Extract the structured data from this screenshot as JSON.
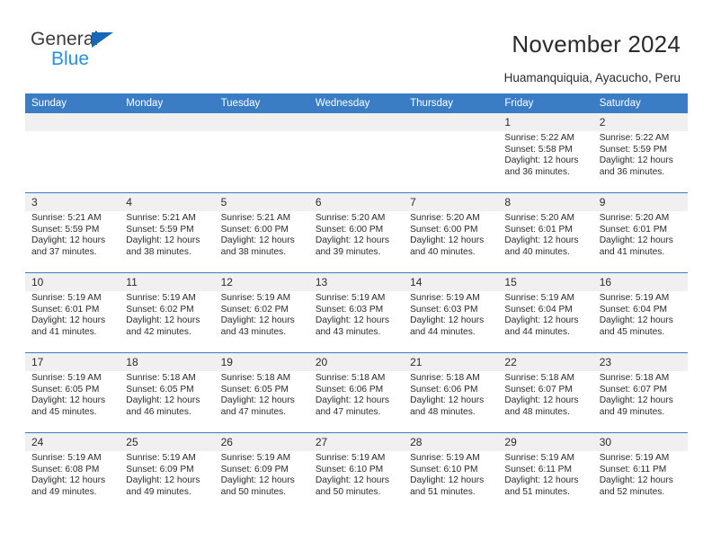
{
  "brand": {
    "name_part1": "General",
    "name_part2": "Blue",
    "accent_color": "#2a8fdd",
    "triangle_color": "#1667b5"
  },
  "header": {
    "title": "November 2024",
    "location": "Huamanquiquia, Ayacucho, Peru"
  },
  "calendar": {
    "header_bg": "#3b7dc4",
    "band_bg": "#f0f0f0",
    "weekdays": [
      "Sunday",
      "Monday",
      "Tuesday",
      "Wednesday",
      "Thursday",
      "Friday",
      "Saturday"
    ],
    "weeks": [
      [
        {
          "day": "",
          "sunrise": "",
          "sunset": "",
          "daylight1": "",
          "daylight2": ""
        },
        {
          "day": "",
          "sunrise": "",
          "sunset": "",
          "daylight1": "",
          "daylight2": ""
        },
        {
          "day": "",
          "sunrise": "",
          "sunset": "",
          "daylight1": "",
          "daylight2": ""
        },
        {
          "day": "",
          "sunrise": "",
          "sunset": "",
          "daylight1": "",
          "daylight2": ""
        },
        {
          "day": "",
          "sunrise": "",
          "sunset": "",
          "daylight1": "",
          "daylight2": ""
        },
        {
          "day": "1",
          "sunrise": "Sunrise: 5:22 AM",
          "sunset": "Sunset: 5:58 PM",
          "daylight1": "Daylight: 12 hours",
          "daylight2": "and 36 minutes."
        },
        {
          "day": "2",
          "sunrise": "Sunrise: 5:22 AM",
          "sunset": "Sunset: 5:59 PM",
          "daylight1": "Daylight: 12 hours",
          "daylight2": "and 36 minutes."
        }
      ],
      [
        {
          "day": "3",
          "sunrise": "Sunrise: 5:21 AM",
          "sunset": "Sunset: 5:59 PM",
          "daylight1": "Daylight: 12 hours",
          "daylight2": "and 37 minutes."
        },
        {
          "day": "4",
          "sunrise": "Sunrise: 5:21 AM",
          "sunset": "Sunset: 5:59 PM",
          "daylight1": "Daylight: 12 hours",
          "daylight2": "and 38 minutes."
        },
        {
          "day": "5",
          "sunrise": "Sunrise: 5:21 AM",
          "sunset": "Sunset: 6:00 PM",
          "daylight1": "Daylight: 12 hours",
          "daylight2": "and 38 minutes."
        },
        {
          "day": "6",
          "sunrise": "Sunrise: 5:20 AM",
          "sunset": "Sunset: 6:00 PM",
          "daylight1": "Daylight: 12 hours",
          "daylight2": "and 39 minutes."
        },
        {
          "day": "7",
          "sunrise": "Sunrise: 5:20 AM",
          "sunset": "Sunset: 6:00 PM",
          "daylight1": "Daylight: 12 hours",
          "daylight2": "and 40 minutes."
        },
        {
          "day": "8",
          "sunrise": "Sunrise: 5:20 AM",
          "sunset": "Sunset: 6:01 PM",
          "daylight1": "Daylight: 12 hours",
          "daylight2": "and 40 minutes."
        },
        {
          "day": "9",
          "sunrise": "Sunrise: 5:20 AM",
          "sunset": "Sunset: 6:01 PM",
          "daylight1": "Daylight: 12 hours",
          "daylight2": "and 41 minutes."
        }
      ],
      [
        {
          "day": "10",
          "sunrise": "Sunrise: 5:19 AM",
          "sunset": "Sunset: 6:01 PM",
          "daylight1": "Daylight: 12 hours",
          "daylight2": "and 41 minutes."
        },
        {
          "day": "11",
          "sunrise": "Sunrise: 5:19 AM",
          "sunset": "Sunset: 6:02 PM",
          "daylight1": "Daylight: 12 hours",
          "daylight2": "and 42 minutes."
        },
        {
          "day": "12",
          "sunrise": "Sunrise: 5:19 AM",
          "sunset": "Sunset: 6:02 PM",
          "daylight1": "Daylight: 12 hours",
          "daylight2": "and 43 minutes."
        },
        {
          "day": "13",
          "sunrise": "Sunrise: 5:19 AM",
          "sunset": "Sunset: 6:03 PM",
          "daylight1": "Daylight: 12 hours",
          "daylight2": "and 43 minutes."
        },
        {
          "day": "14",
          "sunrise": "Sunrise: 5:19 AM",
          "sunset": "Sunset: 6:03 PM",
          "daylight1": "Daylight: 12 hours",
          "daylight2": "and 44 minutes."
        },
        {
          "day": "15",
          "sunrise": "Sunrise: 5:19 AM",
          "sunset": "Sunset: 6:04 PM",
          "daylight1": "Daylight: 12 hours",
          "daylight2": "and 44 minutes."
        },
        {
          "day": "16",
          "sunrise": "Sunrise: 5:19 AM",
          "sunset": "Sunset: 6:04 PM",
          "daylight1": "Daylight: 12 hours",
          "daylight2": "and 45 minutes."
        }
      ],
      [
        {
          "day": "17",
          "sunrise": "Sunrise: 5:19 AM",
          "sunset": "Sunset: 6:05 PM",
          "daylight1": "Daylight: 12 hours",
          "daylight2": "and 45 minutes."
        },
        {
          "day": "18",
          "sunrise": "Sunrise: 5:18 AM",
          "sunset": "Sunset: 6:05 PM",
          "daylight1": "Daylight: 12 hours",
          "daylight2": "and 46 minutes."
        },
        {
          "day": "19",
          "sunrise": "Sunrise: 5:18 AM",
          "sunset": "Sunset: 6:05 PM",
          "daylight1": "Daylight: 12 hours",
          "daylight2": "and 47 minutes."
        },
        {
          "day": "20",
          "sunrise": "Sunrise: 5:18 AM",
          "sunset": "Sunset: 6:06 PM",
          "daylight1": "Daylight: 12 hours",
          "daylight2": "and 47 minutes."
        },
        {
          "day": "21",
          "sunrise": "Sunrise: 5:18 AM",
          "sunset": "Sunset: 6:06 PM",
          "daylight1": "Daylight: 12 hours",
          "daylight2": "and 48 minutes."
        },
        {
          "day": "22",
          "sunrise": "Sunrise: 5:18 AM",
          "sunset": "Sunset: 6:07 PM",
          "daylight1": "Daylight: 12 hours",
          "daylight2": "and 48 minutes."
        },
        {
          "day": "23",
          "sunrise": "Sunrise: 5:18 AM",
          "sunset": "Sunset: 6:07 PM",
          "daylight1": "Daylight: 12 hours",
          "daylight2": "and 49 minutes."
        }
      ],
      [
        {
          "day": "24",
          "sunrise": "Sunrise: 5:19 AM",
          "sunset": "Sunset: 6:08 PM",
          "daylight1": "Daylight: 12 hours",
          "daylight2": "and 49 minutes."
        },
        {
          "day": "25",
          "sunrise": "Sunrise: 5:19 AM",
          "sunset": "Sunset: 6:09 PM",
          "daylight1": "Daylight: 12 hours",
          "daylight2": "and 49 minutes."
        },
        {
          "day": "26",
          "sunrise": "Sunrise: 5:19 AM",
          "sunset": "Sunset: 6:09 PM",
          "daylight1": "Daylight: 12 hours",
          "daylight2": "and 50 minutes."
        },
        {
          "day": "27",
          "sunrise": "Sunrise: 5:19 AM",
          "sunset": "Sunset: 6:10 PM",
          "daylight1": "Daylight: 12 hours",
          "daylight2": "and 50 minutes."
        },
        {
          "day": "28",
          "sunrise": "Sunrise: 5:19 AM",
          "sunset": "Sunset: 6:10 PM",
          "daylight1": "Daylight: 12 hours",
          "daylight2": "and 51 minutes."
        },
        {
          "day": "29",
          "sunrise": "Sunrise: 5:19 AM",
          "sunset": "Sunset: 6:11 PM",
          "daylight1": "Daylight: 12 hours",
          "daylight2": "and 51 minutes."
        },
        {
          "day": "30",
          "sunrise": "Sunrise: 5:19 AM",
          "sunset": "Sunset: 6:11 PM",
          "daylight1": "Daylight: 12 hours",
          "daylight2": "and 52 minutes."
        }
      ]
    ]
  }
}
